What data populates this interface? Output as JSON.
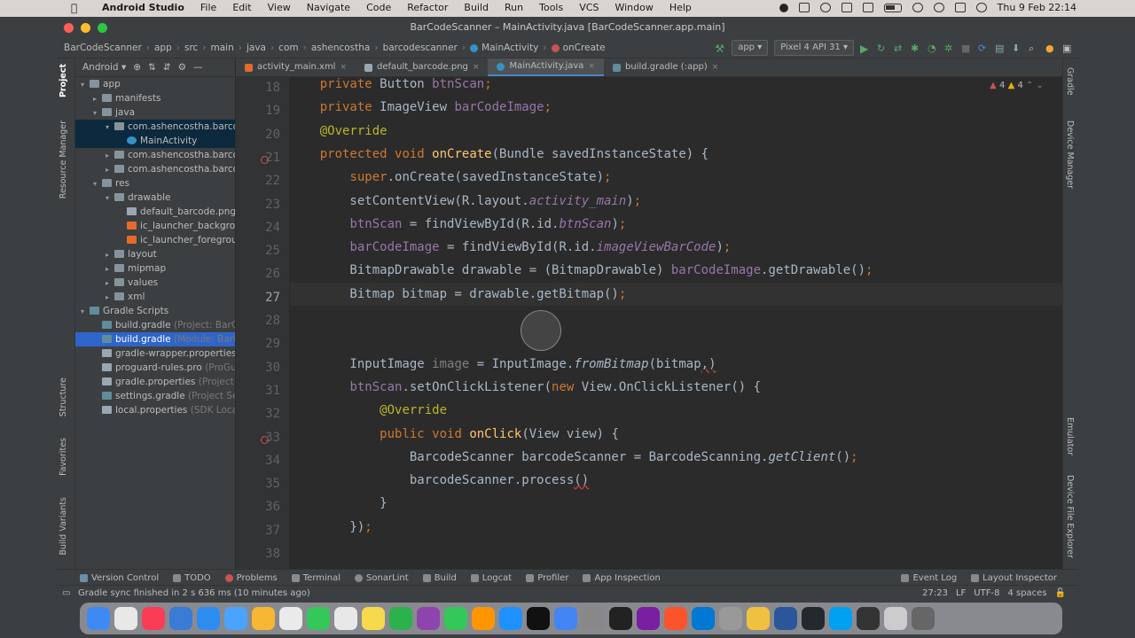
{
  "macos_menubar": {
    "app_name": "Android Studio",
    "menus": [
      "File",
      "Edit",
      "View",
      "Navigate",
      "Code",
      "Refactor",
      "Build",
      "Run",
      "Tools",
      "VCS",
      "Window",
      "Help"
    ],
    "clock": "Thu 9 Feb  22:14"
  },
  "window": {
    "title": "BarCodeScanner – MainActivity.java [BarCodeScanner.app.main]"
  },
  "breadcrumb": [
    "BarCodeScanner",
    "app",
    "src",
    "main",
    "java",
    "com",
    "ashencostha",
    "barcodescanner",
    "MainActivity",
    "onCreate"
  ],
  "toolbar": {
    "run_config": "app",
    "device": "Pixel 4 API 31"
  },
  "project_panel": {
    "view_label": "Android",
    "tree": [
      {
        "label": "app",
        "indent": 0,
        "arrow": "▾",
        "icon": "folder-icon",
        "hint": ""
      },
      {
        "label": "manifests",
        "indent": 1,
        "arrow": "▸",
        "icon": "folder-icon",
        "hint": ""
      },
      {
        "label": "java",
        "indent": 1,
        "arrow": "▾",
        "icon": "folder-icon",
        "hint": ""
      },
      {
        "label": "com.ashencostha.barcod",
        "indent": 2,
        "arrow": "▾",
        "icon": "package-icon",
        "hint": ""
      },
      {
        "label": "MainActivity",
        "indent": 3,
        "arrow": "",
        "icon": "class-icon",
        "hint": ""
      },
      {
        "label": "com.ashencostha.barcod",
        "indent": 2,
        "arrow": "▸",
        "icon": "package-icon",
        "hint": ""
      },
      {
        "label": "com.ashencostha.barcod",
        "indent": 2,
        "arrow": "▸",
        "icon": "package-icon",
        "hint": ""
      },
      {
        "label": "res",
        "indent": 1,
        "arrow": "▾",
        "icon": "folder-icon",
        "hint": ""
      },
      {
        "label": "drawable",
        "indent": 2,
        "arrow": "▾",
        "icon": "folder-icon",
        "hint": ""
      },
      {
        "label": "default_barcode.png",
        "indent": 3,
        "arrow": "",
        "icon": "image-icon",
        "hint": ""
      },
      {
        "label": "ic_launcher_backgro",
        "indent": 3,
        "arrow": "",
        "icon": "xml-icon",
        "hint": ""
      },
      {
        "label": "ic_launcher_foregrou",
        "indent": 3,
        "arrow": "",
        "icon": "xml-icon",
        "hint": ""
      },
      {
        "label": "layout",
        "indent": 2,
        "arrow": "▸",
        "icon": "folder-icon",
        "hint": ""
      },
      {
        "label": "mipmap",
        "indent": 2,
        "arrow": "▸",
        "icon": "folder-icon",
        "hint": ""
      },
      {
        "label": "values",
        "indent": 2,
        "arrow": "▸",
        "icon": "folder-icon",
        "hint": ""
      },
      {
        "label": "xml",
        "indent": 2,
        "arrow": "▸",
        "icon": "folder-icon",
        "hint": ""
      },
      {
        "label": "Gradle Scripts",
        "indent": 0,
        "arrow": "▾",
        "icon": "gradle-icon",
        "hint": ""
      },
      {
        "label": "build.gradle",
        "indent": 1,
        "arrow": "",
        "icon": "gradle-icon",
        "hint": "(Project: BarC"
      },
      {
        "label": "build.gradle",
        "indent": 1,
        "arrow": "",
        "icon": "gradle-icon",
        "hint": "(Module: BarC"
      },
      {
        "label": "gradle-wrapper.properties",
        "indent": 1,
        "arrow": "",
        "icon": "properties-icon",
        "hint": ""
      },
      {
        "label": "proguard-rules.pro",
        "indent": 1,
        "arrow": "",
        "icon": "properties-icon",
        "hint": "(ProGu"
      },
      {
        "label": "gradle.properties",
        "indent": 1,
        "arrow": "",
        "icon": "properties-icon",
        "hint": "(Project P"
      },
      {
        "label": "settings.gradle",
        "indent": 1,
        "arrow": "",
        "icon": "gradle-icon",
        "hint": "(Project Set"
      },
      {
        "label": "local.properties",
        "indent": 1,
        "arrow": "",
        "icon": "properties-icon",
        "hint": "(SDK Locat"
      }
    ]
  },
  "tabs": [
    {
      "label": "activity_main.xml",
      "icon": "xml-icon",
      "active": false
    },
    {
      "label": "default_barcode.png",
      "icon": "image-icon",
      "active": false
    },
    {
      "label": "MainActivity.java",
      "icon": "class-icon",
      "active": true
    },
    {
      "label": "build.gradle (:app)",
      "icon": "gradle-icon",
      "active": false
    }
  ],
  "editor": {
    "inspection_counts": {
      "warnings": "4",
      "weak_warnings": "4"
    },
    "line_numbers": [
      "18",
      "19",
      "20",
      "21",
      "22",
      "23",
      "24",
      "25",
      "26",
      "27",
      "28",
      "29",
      "30",
      "31",
      "32",
      "33",
      "34",
      "35",
      "36",
      "37",
      "38"
    ],
    "lines": [
      "    private Button btnScan;",
      "    private ImageView barCodeImage;",
      "    @Override",
      "    protected void onCreate(Bundle savedInstanceState) {",
      "        super.onCreate(savedInstanceState);",
      "        setContentView(R.layout.activity_main);",
      "        btnScan = findViewById(R.id.btnScan);",
      "        barCodeImage = findViewById(R.id.imageViewBarCode);",
      "        BitmapDrawable drawable = (BitmapDrawable) barCodeImage.getDrawable();",
      "        Bitmap bitmap = drawable.getBitmap();",
      "",
      "",
      "        InputImage image = InputImage.fromBitmap(bitmap,)",
      "        btnScan.setOnClickListener(new View.OnClickListener() {",
      "            @Override",
      "            public void onClick(View view) {",
      "                BarcodeScanner barcodeScanner = BarcodeScanning.getClient();",
      "                barcodeScanner.process()",
      "            }",
      "        });",
      ""
    ]
  },
  "bottom_tools": [
    "Version Control",
    "TODO",
    "Problems",
    "Terminal",
    "SonarLint",
    "Build",
    "Logcat",
    "Profiler",
    "App Inspection",
    "Event Log",
    "Layout Inspector"
  ],
  "status": {
    "message": "Gradle sync finished in 2 s 636 ms (10 minutes ago)",
    "position": "27:23",
    "line_sep": "LF",
    "encoding": "UTF-8",
    "indent": "4 spaces"
  },
  "side_tabs": {
    "left": [
      "Project",
      "Resource Manager",
      "Structure",
      "Favorites",
      "Build Variants"
    ],
    "right": [
      "Gradle",
      "Device Manager",
      "Emulator",
      "Device File Explorer"
    ]
  },
  "colors": {
    "keyword": "#cc7832",
    "field": "#9876aa",
    "method": "#ffc66d",
    "annotation": "#bbb529",
    "text": "#a9b7c6",
    "selection": "#2f65ca"
  }
}
